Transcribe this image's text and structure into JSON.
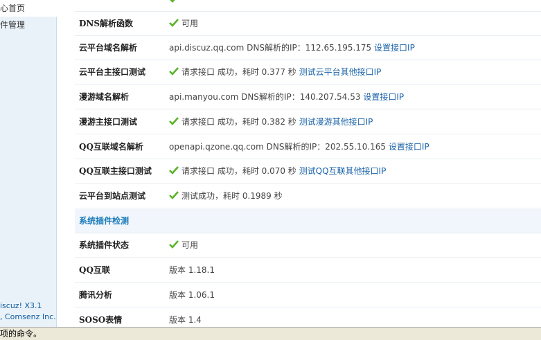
{
  "sidebar": {
    "items": [
      {
        "label": "心首页",
        "active": true
      },
      {
        "label": "件管理",
        "active": false
      }
    ],
    "footer": [
      "iscuz! X3.1",
      ", Comsenz Inc."
    ]
  },
  "rows_top": [
    {
      "label": "DNS解析函数",
      "status": "可用"
    },
    {
      "label": "云平台域名解析",
      "host": "api.discuz.qq.com",
      "dns_text": "DNS解析的IP：112.65.195.175",
      "link": "设置接口IP"
    },
    {
      "label": "云平台主接口测试",
      "status": "请求接口 成功，耗时 0.377 秒",
      "link": "测试云平台其他接口IP"
    },
    {
      "label": "漫游域名解析",
      "host": "api.manyou.com",
      "dns_text": "DNS解析的IP：140.207.54.53",
      "link": "设置接口IP"
    },
    {
      "label": "漫游主接口测试",
      "status": "请求接口 成功，耗时 0.382 秒",
      "link": "测试漫游其他接口IP"
    },
    {
      "label": "QQ互联域名解析",
      "host": "openapi.qzone.qq.com",
      "dns_text": "DNS解析的IP：202.55.10.165",
      "link": "设置接口IP"
    },
    {
      "label": "QQ互联主接口测试",
      "status": "请求接口 成功，耗时 0.070 秒",
      "link": "测试QQ互联其他接口IP"
    },
    {
      "label": "云平台到站点测试",
      "status": "测试成功，耗时 0.1989 秒"
    }
  ],
  "section_title": "系统插件检测",
  "rows_bottom": [
    {
      "label": "系统插件状态",
      "status": "可用"
    },
    {
      "label": "QQ互联",
      "value": "版本 1.18.1"
    },
    {
      "label": "腾讯分析",
      "value": "版本 1.06.1"
    },
    {
      "label": "SOSO表情",
      "value": "版本 1.4"
    }
  ],
  "statusbar": {
    "text": "项的命令。"
  },
  "colors": {
    "check": "#5bb22a",
    "link": "#1a62a8",
    "section": "#1b7ab8"
  }
}
